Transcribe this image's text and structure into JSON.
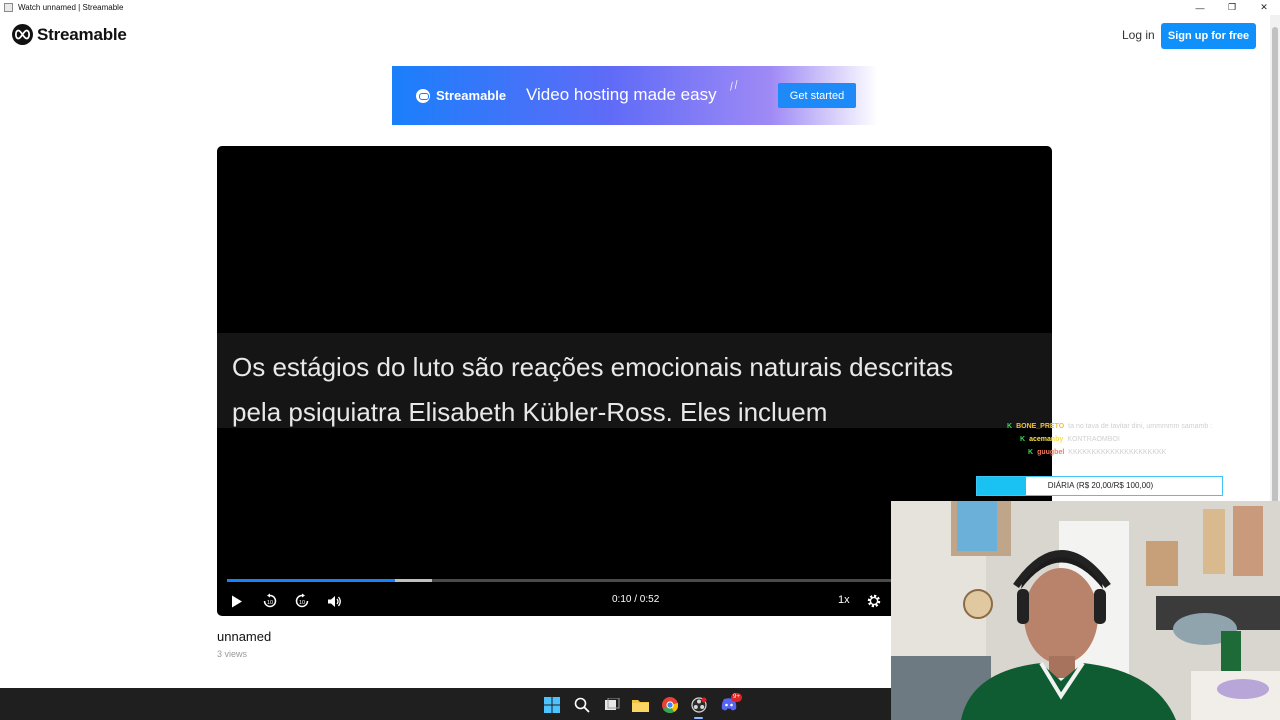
{
  "window": {
    "title": "Watch unnamed | Streamable",
    "controls": [
      "—",
      "❐",
      "✕"
    ]
  },
  "header": {
    "logo_text": "Streamable",
    "login_label": "Log in",
    "signup_label": "Sign up for free"
  },
  "banner": {
    "logo_text": "Streamable",
    "tagline": "Video hosting made easy",
    "cta_label": "Get started"
  },
  "player": {
    "subtitle": "Os estágios do luto são reações emocionais naturais descritas\npela psiquiatra Elisabeth Kübler-Ross. Eles incluem",
    "time": "0:10 / 0:52",
    "speed": "1x",
    "progress_played": 0.206,
    "progress_buffered": 0.252,
    "icons": [
      "play-icon",
      "rewind-10-icon",
      "forward-10-icon",
      "volume-icon",
      "gear-icon"
    ]
  },
  "video_meta": {
    "title": "unnamed",
    "views": "3 views"
  },
  "overlay": {
    "chat": [
      {
        "badge": "K",
        "user": "BONE_PRETO",
        "color": "#f2c230",
        "message": "ta no tava de tavitar dini, ummmmm samamb :"
      },
      {
        "badge": "K",
        "user": "acemanby",
        "color": "#f7e04a",
        "message": "KONTRAOMBOI"
      },
      {
        "badge": "K",
        "user": "guugbel",
        "color": "#f27a5a",
        "message": "KKKKKKKKKKKKKKKKKKKKK"
      }
    ],
    "goal": {
      "label": "DIÁRIA (R$ 20,00/R$ 100,00)",
      "fraction": 0.2
    }
  },
  "taskbar": {
    "icons": [
      "windows-start-icon",
      "search-icon",
      "task-view-icon",
      "file-explorer-icon",
      "chrome-icon",
      "obs-icon",
      "discord-icon"
    ],
    "discord_badge": "9+"
  }
}
